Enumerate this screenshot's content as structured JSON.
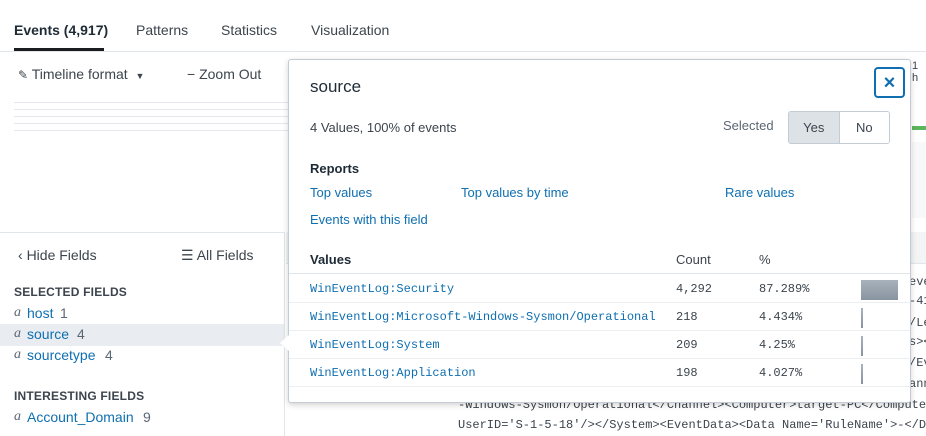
{
  "tabs": [
    {
      "label": "Events (4,917)",
      "active": true
    },
    {
      "label": "Patterns",
      "active": false
    },
    {
      "label": "Statistics",
      "active": false
    },
    {
      "label": "Visualization",
      "active": false
    }
  ],
  "timeline": {
    "format_label": "Timeline format",
    "zoom_out_label": "Zoom Out",
    "right_peek_text": "1 h"
  },
  "sidebar": {
    "hide_fields": "Hide Fields",
    "all_fields": "All Fields",
    "selected_heading": "SELECTED FIELDS",
    "interesting_heading": "INTERESTING FIELDS",
    "selected_fields": [
      {
        "type": "a",
        "name": "host",
        "count": "1",
        "selected": false
      },
      {
        "type": "a",
        "name": "source",
        "count": "4",
        "selected": true
      },
      {
        "type": "a",
        "name": "sourcetype",
        "count": "4",
        "selected": false
      }
    ],
    "interesting_fields": [
      {
        "type": "a",
        "name": "Account_Domain",
        "count": "9",
        "selected": false
      }
    ]
  },
  "results": {
    "right_edge_lines": [
      "eve",
      "-41",
      "/Le",
      "s><",
      "/Ev",
      "ann"
    ],
    "bottom_line_1": "-Windows-Sysmon/Operational</Channel><Computer>target-PC</Compute",
    "bottom_line_2": "UserID='S-1-5-18'/></System><EventData><Data Name='RuleName'>-</D"
  },
  "popover": {
    "title": "source",
    "close_symbol": "×",
    "summary": "4 Values, 100% of events",
    "selected_label": "Selected",
    "toggle_yes": "Yes",
    "toggle_no": "No",
    "selected_value": "Yes",
    "reports_heading": "Reports",
    "report_links": {
      "top_values": "Top values",
      "top_values_by_time": "Top values by time",
      "rare_values": "Rare values",
      "events_with_field": "Events with this field"
    },
    "table_headers": {
      "values": "Values",
      "count": "Count",
      "percent": "%"
    },
    "rows": [
      {
        "value": "WinEventLog:Security",
        "count": "4,292",
        "percent": "87.289%",
        "pct": 87.289
      },
      {
        "value": "WinEventLog:Microsoft-Windows-Sysmon/Operational",
        "count": "218",
        "percent": "4.434%",
        "pct": 4.434
      },
      {
        "value": "WinEventLog:System",
        "count": "209",
        "percent": "4.25%",
        "pct": 4.25
      },
      {
        "value": "WinEventLog:Application",
        "count": "198",
        "percent": "4.027%",
        "pct": 4.027
      }
    ]
  },
  "colors": {
    "link": "#0f6fb0",
    "accent_underline": "#1a1c20",
    "timeline_green": "#5cb55a",
    "bar_fill": "#8894a0"
  }
}
